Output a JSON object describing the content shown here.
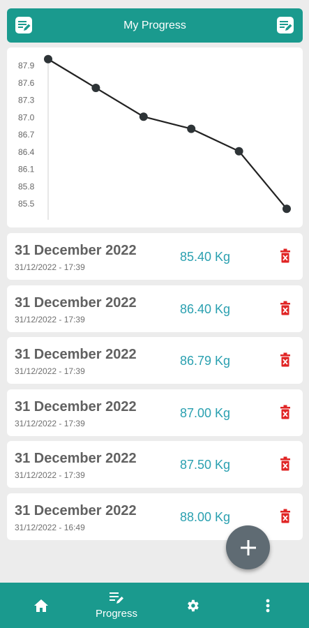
{
  "app_bar": {
    "title": "My Progress",
    "left_icon": "edit-note-icon",
    "right_icon": "edit-note-icon"
  },
  "colors": {
    "primary": "#1a9a8e",
    "weight_text": "#2aa0b0",
    "delete": "#e02424",
    "fab": "#5f6b73"
  },
  "chart_data": {
    "type": "line",
    "title": "",
    "xlabel": "",
    "ylabel": "",
    "y_ticks": [
      "87.9",
      "87.6",
      "87.3",
      "87.0",
      "86.7",
      "86.4",
      "86.1",
      "85.8",
      "85.5"
    ],
    "ylim": [
      85.4,
      88.0
    ],
    "x": [
      1,
      2,
      3,
      4,
      5,
      6
    ],
    "series": [
      {
        "values": [
          88.0,
          87.5,
          87.0,
          86.79,
          86.4,
          85.4
        ]
      }
    ],
    "grid": false
  },
  "entries": [
    {
      "date": "31 December 2022",
      "timestamp": "31/12/2022 - 17:39",
      "weight": "85.40 Kg"
    },
    {
      "date": "31 December 2022",
      "timestamp": "31/12/2022 - 17:39",
      "weight": "86.40 Kg"
    },
    {
      "date": "31 December 2022",
      "timestamp": "31/12/2022 - 17:39",
      "weight": "86.79 Kg"
    },
    {
      "date": "31 December 2022",
      "timestamp": "31/12/2022 - 17:39",
      "weight": "87.00 Kg"
    },
    {
      "date": "31 December 2022",
      "timestamp": "31/12/2022 - 17:39",
      "weight": "87.50 Kg"
    },
    {
      "date": "31 December 2022",
      "timestamp": "31/12/2022 - 16:49",
      "weight": "88.00 Kg"
    }
  ],
  "fab": {
    "icon": "plus-icon"
  },
  "bottom_nav": {
    "home_icon": "home-icon",
    "progress_icon": "edit-note-icon",
    "progress_label": "Progress",
    "settings_icon": "gear-icon",
    "more_icon": "more-vertical-icon"
  }
}
